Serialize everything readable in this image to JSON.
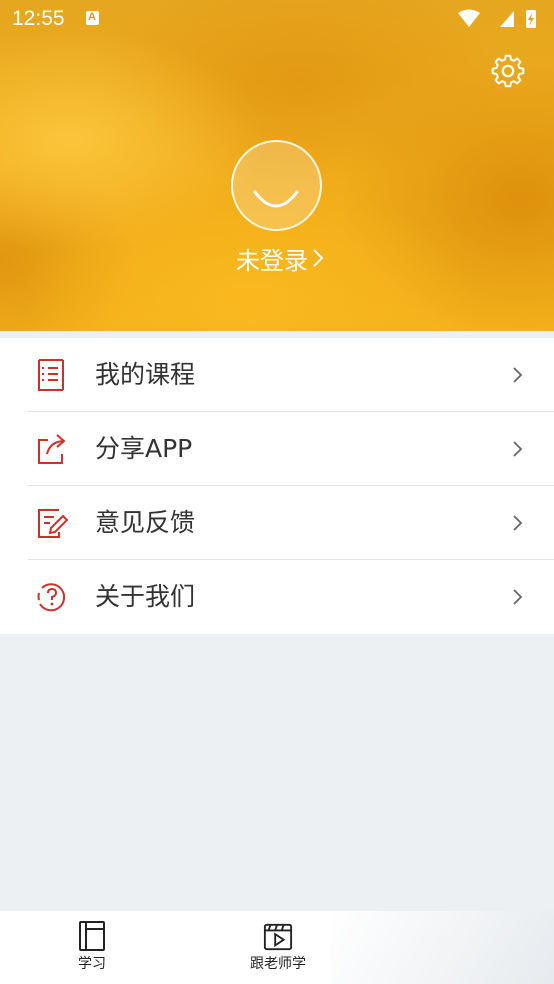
{
  "status_bar": {
    "time": "12:55",
    "indicator_letter": "A"
  },
  "header": {
    "login_text": "未登录",
    "settings_icon": "gear-icon",
    "avatar_icon": "smiley-avatar-icon"
  },
  "menu": {
    "items": [
      {
        "label": "我的课程",
        "icon": "course-list-icon"
      },
      {
        "label": "分享APP",
        "icon": "share-icon"
      },
      {
        "label": "意见反馈",
        "icon": "feedback-icon"
      },
      {
        "label": "关于我们",
        "icon": "help-icon"
      }
    ]
  },
  "tabbar": {
    "tabs": [
      {
        "label": "学习",
        "icon": "book-icon"
      },
      {
        "label": "跟老师学",
        "icon": "video-icon"
      }
    ]
  },
  "colors": {
    "accent_red": "#d0302a",
    "header_gold": "#f0ac1a"
  }
}
